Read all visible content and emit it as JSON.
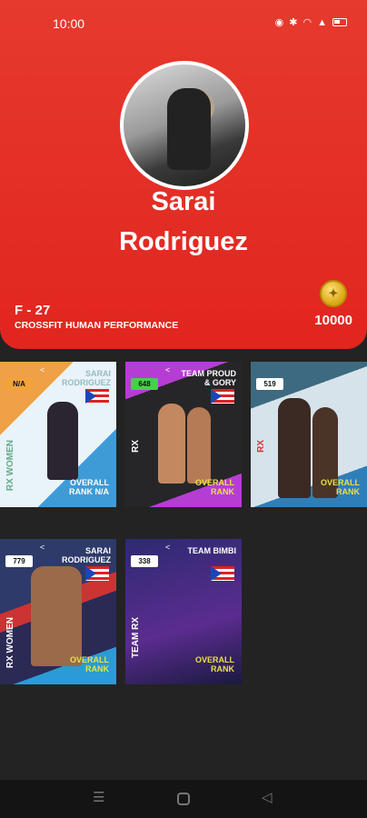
{
  "status_bar": {
    "time": "10:00",
    "icons": [
      "eye-icon",
      "bluetooth-icon",
      "wifi-icon",
      "signal-icon",
      "battery-icon"
    ]
  },
  "profile": {
    "first_name": "Sarai",
    "last_name": "Rodriguez",
    "division": "F - 27",
    "affiliation": "CROSSFIT HUMAN PERFORMANCE",
    "points": "10000",
    "coin_icon": "coin-icon"
  },
  "cards": [
    {
      "badge": "N/A",
      "badge_color": "#f3a33a",
      "team": "SARAI RODRIGUEZ",
      "side_label": "RX WOMEN",
      "overall": "OVERALL RANK N/A"
    },
    {
      "badge": "648",
      "badge_color": "#46d147",
      "team": "TEAM PROUD & GORY",
      "side_label": "RX",
      "overall": "OVERALL RANK"
    },
    {
      "badge": "519",
      "badge_color": "#ffffff",
      "team": "",
      "side_label": "RX",
      "overall": "OVERALL RANK"
    },
    {
      "badge": "779",
      "badge_color": "#ffffff",
      "team": "SARAI RODRIGUEZ",
      "side_label": "RX WOMEN",
      "overall": "OVERALL RANK"
    },
    {
      "badge": "338",
      "badge_color": "#ffffff",
      "team": "TEAM BIMBI",
      "side_label": "TEAM RX",
      "overall": "OVERALL RANK"
    }
  ],
  "nav_bar": {
    "icons": [
      "menu-icon",
      "home-icon",
      "back-icon"
    ]
  }
}
